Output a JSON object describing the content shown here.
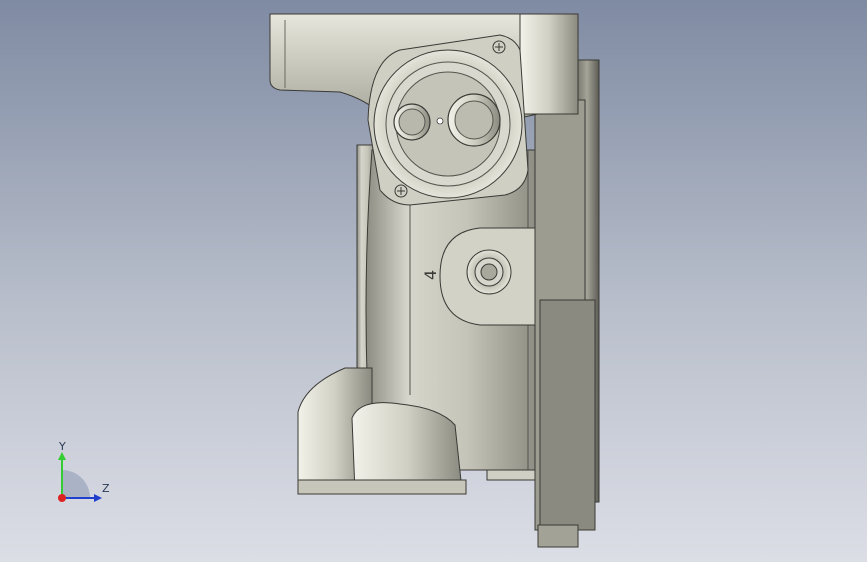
{
  "viewport": {
    "background_top": "#7f8ba3",
    "background_bottom": "#dcdee6",
    "part_color": "#b4b4a6"
  },
  "part": {
    "engraved_label": "4"
  },
  "triad": {
    "y_label": "Y",
    "z_label": "Z",
    "y_color": "#33cc33",
    "z_color": "#1f3fcc",
    "x_color": "#dd2222"
  }
}
